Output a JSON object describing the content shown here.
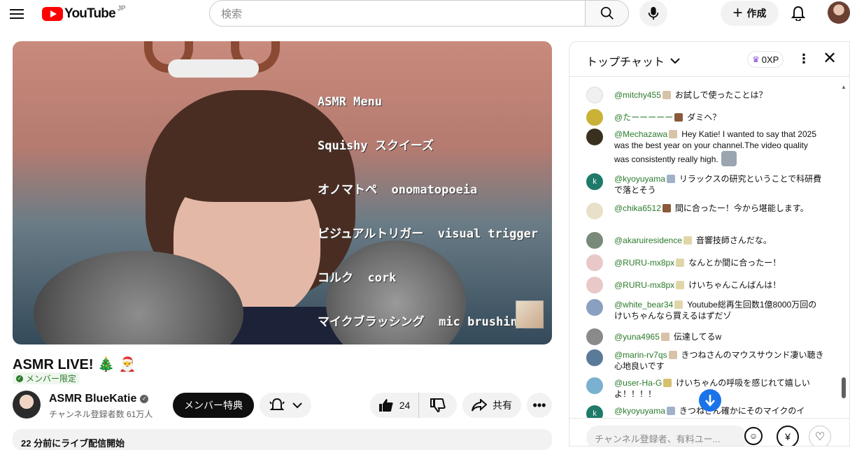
{
  "header": {
    "logo_text": "YouTube",
    "logo_region": "JP",
    "search_placeholder": "検索",
    "create_label": "作成",
    "icons": [
      "menu-icon",
      "search-icon",
      "mic-icon",
      "plus-icon",
      "bell-icon"
    ]
  },
  "video": {
    "overlay_lines": [
      "ASMR Menu",
      "Squishy スクイーズ",
      "オノマトペ  onomatopoeia",
      "ビジュアルトリガー  visual trigger",
      "コルク  cork",
      "マイクブラッシング  mic brushing"
    ],
    "title": "ASMR LIVE! 🎄 🎅",
    "members_badge": "メンバー限定"
  },
  "channel": {
    "name": "ASMR BlueKatie",
    "subscribers": "チャンネル登録者数 61万人",
    "join_label": "メンバー特典"
  },
  "actions": {
    "like_count": "24",
    "share_label": "共有",
    "more_label": "•••"
  },
  "description": {
    "preview": "22 分前にライブ配信開始"
  },
  "chat": {
    "mode": "トップチャット",
    "xp": "0XP",
    "input_placeholder": "チャンネル登録者、有料ユー...",
    "messages": [
      {
        "author": "@mitchy455",
        "text": "お試しで使ったことは？"
      },
      {
        "author": "@たーーーーー",
        "text": "ダミヘ？"
      },
      {
        "author": "@Mechazawa",
        "text": "Hey Katie! I wanted to say that 2025 was the best year on your channel.The video quality was consistently really high."
      },
      {
        "author": "@kyoyuyama",
        "text": "リラックスの研究ということで科研費で落とそう"
      },
      {
        "author": "@chika6512",
        "text": "間に合ったー！今から堪能します。"
      },
      {
        "author": "@akaruiresidence",
        "text": "音響技師さんだな。"
      },
      {
        "author": "@RURU-mx8px",
        "text": "なんとか間に合ったー！"
      },
      {
        "author": "@RURU-mx8px",
        "text": "けいちゃんこんばんは！"
      },
      {
        "author": "@white_bear34",
        "text": "Youtube総再生回数1億8000万回のけいちゃんなら買えるはずだゾ"
      },
      {
        "author": "@yuna4965",
        "text": "伝達してるw"
      },
      {
        "author": "@marin-rv7qs",
        "text": "きつねさんのマウスサウンド凄い聴き心地良いです"
      },
      {
        "author": "@user-Ha-G",
        "text": "けいちゃんの呼吸を感じれて嬉しいよ！！！！"
      },
      {
        "author": "@kyoyuyama",
        "text": "きつねさん確かにそのマイクのイ"
      }
    ]
  }
}
